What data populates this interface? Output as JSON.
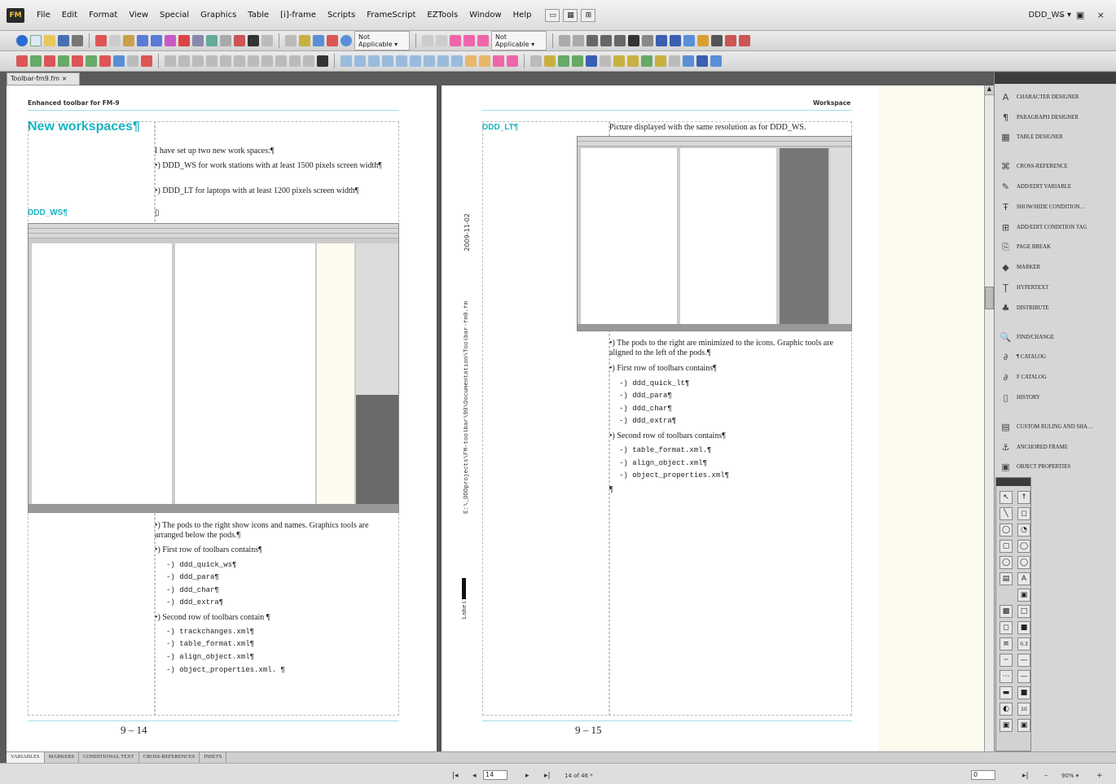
{
  "app": {
    "logo": "FM",
    "workspace": "DDD_WS ▾",
    "window_controls": "– ▣ ×"
  },
  "menu": [
    "File",
    "Edit",
    "Format",
    "View",
    "Special",
    "Graphics",
    "Table",
    "[i]-frame",
    "Scripts",
    "FrameScript",
    "EZTools",
    "Window",
    "Help"
  ],
  "toolbar": {
    "select1": "Not Applicable ▾",
    "select2": "Not Applicable ▾"
  },
  "doc_tab": "Toolbar-fm9.fm ×",
  "left_page": {
    "header": "Enhanced toolbar for FM-9",
    "title": "New workspaces¶",
    "intro": "I have set up two new work spaces:¶",
    "bullets": [
      "•) DDD_WS for work stations with at least 1500 pixels screen width¶",
      "•) DDD_LT for laptops with at least 1200 pixels screen width¶"
    ],
    "section": "DDD_WS¶",
    "anchor": "▯",
    "desc_bullets": [
      "•) The pods to the right show icons and names. Graphics tools are arranged below the pods.¶",
      "•) First row of toolbars contains¶"
    ],
    "first_row": [
      "-) ddd_quick_ws¶",
      "-) ddd_para¶",
      "-) ddd_char¶",
      "-) ddd_extra¶"
    ],
    "second_intro": "•) Second row of toolbars contain ¶",
    "second_row": [
      "-) trackchanges.xml¶",
      "-) table_format.xml¶",
      "-) align_object.xml¶",
      "-) object_properties.xml. ¶"
    ],
    "page_number": "9 – 14"
  },
  "right_page": {
    "header": "Workspace",
    "section": "DDD_LT¶",
    "caption": "Picture displayed with the same resolution as for DDD_WS.",
    "desc_bullets": [
      "•) The pods to the right are minimized to the icons. Graphic tools are aligned to the left of the pods.¶",
      "•) First row of toolbars contains¶"
    ],
    "first_row": [
      "-) ddd_quick_lt¶",
      "-) ddd_para¶",
      "-) ddd_char¶",
      "-) ddd_extra¶"
    ],
    "second_intro": "•) Second row of toolbars contains¶",
    "second_row": [
      "-) table_format.xml.¶",
      "-) align_object.xml¶",
      "-) object_properties.xml¶"
    ],
    "end_mark": "¶",
    "side_date": "2009-11-02",
    "side_path": "E:\\_DDDprojects\\FM-toolbar\\90\\Documentation\\Toolbar-fm9.fm",
    "side_label": "Label",
    "page_number": "9 – 15"
  },
  "pods": [
    {
      "label": "CHARACTER DESIGNER",
      "icon": "A"
    },
    {
      "label": "PARAGRAPH DESIGNER",
      "icon": "¶"
    },
    {
      "label": "TABLE DESIGNER",
      "icon": "▦"
    },
    {
      "label": "CROSS-REFERENCE",
      "icon": "⌘"
    },
    {
      "label": "ADD/EDIT VARIABLE",
      "icon": "✎"
    },
    {
      "label": "SHOW/HIDE CONDITION…",
      "icon": "Ŧ"
    },
    {
      "label": "ADD/EDIT CONDITION TAG",
      "icon": "⊞"
    },
    {
      "label": "PAGE BREAK",
      "icon": "⎘"
    },
    {
      "label": "MARKER",
      "icon": "◆"
    },
    {
      "label": "HYPERTEXT",
      "icon": "Ţ"
    },
    {
      "label": "DISTRIBUTE",
      "icon": "♣"
    },
    {
      "label": "FIND/CHANGE",
      "icon": "🔍"
    },
    {
      "label": "¶ CATALOG",
      "icon": "∂"
    },
    {
      "label": "F CATALOG",
      "icon": "∂"
    },
    {
      "label": "HISTORY",
      "icon": "▯"
    },
    {
      "label": "CUSTOM RULING AND SHA…",
      "icon": "▤"
    },
    {
      "label": "ANCHORED FRAME",
      "icon": "⚓"
    },
    {
      "label": "OBJECT PROPERTIES",
      "icon": "▣"
    }
  ],
  "tools": [
    "↖",
    "↑",
    "╲",
    "◻",
    "◯",
    "◔",
    "▢",
    "◯",
    "◯",
    "◯",
    "▤",
    "A",
    "",
    "▣",
    "▩",
    "□",
    "◻",
    "■",
    "≡",
    "0.3",
    "╌",
    "—",
    "⋯",
    "—",
    "▬",
    "■",
    "◐",
    "10",
    "▣",
    "▣"
  ],
  "bottom_tabs": [
    "VARIABLES",
    "MARKERS",
    "CONDITIONAL TEXT",
    "CROSS-REFERENCES",
    "INSETS"
  ],
  "status": {
    "page_field": "14",
    "page_of": "14 of 46 *",
    "zoom": "90% ▾",
    "left_field": "0"
  },
  "colors": {
    "heading": "#16b4c2",
    "cream": "#fdfaee",
    "dark": "#555555"
  }
}
